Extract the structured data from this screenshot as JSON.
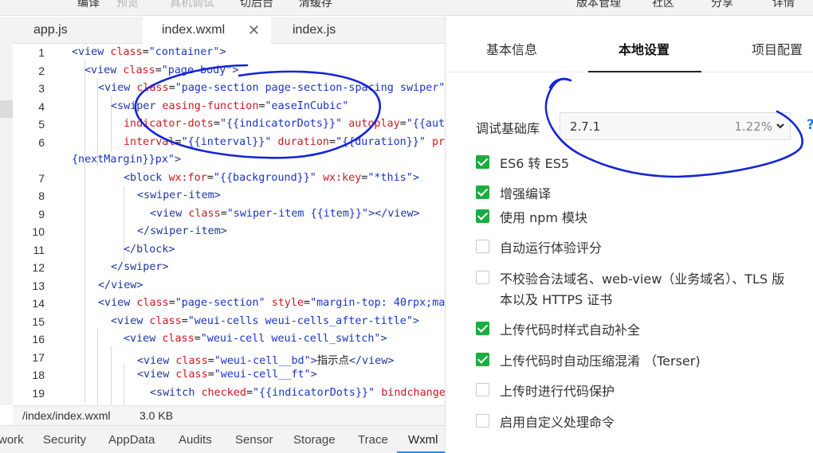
{
  "toolbar": {
    "items": [
      "编译",
      "预览",
      "真机调试",
      "切后台",
      "清缓存",
      "版本管理",
      "社区",
      "分享",
      "详情"
    ]
  },
  "editor": {
    "tabs": [
      {
        "label": "app.js",
        "active": false
      },
      {
        "label": "index.wxml",
        "active": true,
        "close_icon": "close-icon"
      },
      {
        "label": "index.js",
        "active": false
      }
    ],
    "line_numbers": [
      "1",
      "2",
      "3",
      "4",
      "5",
      "6",
      "",
      "7",
      "8",
      "9",
      "10",
      "11",
      "12",
      "13",
      "14",
      "15",
      "16",
      "17",
      "18",
      "19"
    ]
  },
  "status": {
    "path": "/index/index.wxml",
    "size": "3.0 KB"
  },
  "bottom_tabs": [
    "work",
    "Security",
    "AppData",
    "Audits",
    "Sensor",
    "Storage",
    "Trace",
    "Wxml"
  ],
  "bottom_active": "Wxml",
  "settings": {
    "tabs": [
      "基本信息",
      "本地设置",
      "项目配置"
    ],
    "active_tab": "本地设置",
    "base_lib_label": "调试基础库",
    "base_lib_value": "2.7.1",
    "base_lib_percent": "1.22%",
    "help": "?",
    "options": [
      {
        "label": "ES6 转 ES5",
        "checked": true
      },
      {
        "label": "增强编译",
        "checked": true
      },
      {
        "label": "使用 npm 模块",
        "checked": true
      },
      {
        "label": "自动运行体验评分",
        "checked": false
      },
      {
        "label": "不校验合法域名、web-view（业务域名）、TLS 版",
        "label2": "本以及 HTTPS 证书",
        "checked": false
      },
      {
        "label": "上传代码时样式自动补全",
        "checked": true
      },
      {
        "label": "上传代码时自动压缩混淆 （Terser)",
        "checked": true
      },
      {
        "label": "上传时进行代码保护",
        "checked": false
      },
      {
        "label": "启用自定义处理命令",
        "checked": false
      }
    ]
  },
  "colors": {
    "checkbox_on": "#1aad3f",
    "annotation": "#1424d6",
    "tag": "#1e37a0",
    "attr": "#d0181f",
    "string": "#1a33c8"
  }
}
